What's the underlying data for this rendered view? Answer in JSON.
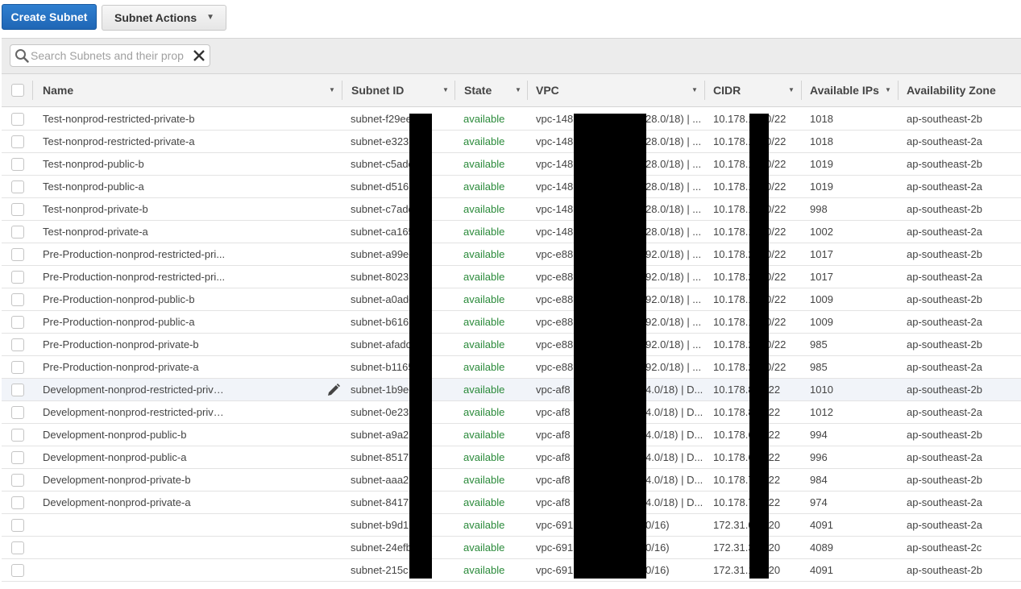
{
  "toolbar": {
    "create_label": "Create Subnet",
    "actions_label": "Subnet Actions",
    "actions_caret": "▼"
  },
  "search": {
    "placeholder": "Search Subnets and their prop"
  },
  "columns": [
    {
      "key": "name",
      "label": "Name"
    },
    {
      "key": "subnet_id",
      "label": "Subnet ID"
    },
    {
      "key": "state",
      "label": "State"
    },
    {
      "key": "vpc",
      "label": "VPC"
    },
    {
      "key": "cidr",
      "label": "CIDR"
    },
    {
      "key": "available_ips",
      "label": "Available IPs"
    },
    {
      "key": "availability_zone",
      "label": "Availability Zone"
    }
  ],
  "sort_arrow": "▼",
  "colors": {
    "accent": "#1f66b5",
    "state_available": "#2a8a3a",
    "selected_row": "#f1f4f9"
  },
  "icons": {
    "search": "search-icon",
    "clear": "close-icon",
    "edit": "pencil-icon"
  },
  "rows": [
    {
      "name": "Test-nonprod-restricted-private-b",
      "subnet_id": "subnet-f29ee",
      "state": "available",
      "vpc": "vpc-148",
      "vpc_tail": "28.0/18) | ...",
      "cidr": "10.178.1",
      "cidr_tail": "0/22",
      "available_ips": "1018",
      "availability_zone": "ap-southeast-2b"
    },
    {
      "name": "Test-nonprod-restricted-private-a",
      "subnet_id": "subnet-e323",
      "state": "available",
      "vpc": "vpc-148",
      "vpc_tail": "28.0/18) | ...",
      "cidr": "10.178.1",
      "cidr_tail": "0/22",
      "available_ips": "1018",
      "availability_zone": "ap-southeast-2a"
    },
    {
      "name": "Test-nonprod-public-b",
      "subnet_id": "subnet-c5add",
      "state": "available",
      "vpc": "vpc-148",
      "vpc_tail": "28.0/18) | ...",
      "cidr": "10.178.1",
      "cidr_tail": "0/22",
      "available_ips": "1019",
      "availability_zone": "ap-southeast-2b"
    },
    {
      "name": "Test-nonprod-public-a",
      "subnet_id": "subnet-d5165",
      "state": "available",
      "vpc": "vpc-148",
      "vpc_tail": "28.0/18) | ...",
      "cidr": "10.178.1",
      "cidr_tail": "0/22",
      "available_ips": "1019",
      "availability_zone": "ap-southeast-2a"
    },
    {
      "name": "Test-nonprod-private-b",
      "subnet_id": "subnet-c7add",
      "state": "available",
      "vpc": "vpc-148",
      "vpc_tail": "28.0/18) | ...",
      "cidr": "10.178.1",
      "cidr_tail": "0/22",
      "available_ips": "998",
      "availability_zone": "ap-southeast-2b"
    },
    {
      "name": "Test-nonprod-private-a",
      "subnet_id": "subnet-ca165",
      "state": "available",
      "vpc": "vpc-148",
      "vpc_tail": "28.0/18) | ...",
      "cidr": "10.178.1",
      "cidr_tail": "0/22",
      "available_ips": "1002",
      "availability_zone": "ap-southeast-2a"
    },
    {
      "name": "Pre-Production-nonprod-restricted-pri...",
      "subnet_id": "subnet-a99ee",
      "state": "available",
      "vpc": "vpc-e88",
      "vpc_tail": "92.0/18) | ...",
      "cidr": "10.178.2",
      "cidr_tail": "0/22",
      "available_ips": "1017",
      "availability_zone": "ap-southeast-2b"
    },
    {
      "name": "Pre-Production-nonprod-restricted-pri...",
      "subnet_id": "subnet-8023",
      "state": "available",
      "vpc": "vpc-e88",
      "vpc_tail": "92.0/18) | ...",
      "cidr": "10.178.2",
      "cidr_tail": "0/22",
      "available_ips": "1017",
      "availability_zone": "ap-southeast-2a"
    },
    {
      "name": "Pre-Production-nonprod-public-b",
      "subnet_id": "subnet-a0add",
      "state": "available",
      "vpc": "vpc-e88",
      "vpc_tail": "92.0/18) | ...",
      "cidr": "10.178.1",
      "cidr_tail": "0/22",
      "available_ips": "1009",
      "availability_zone": "ap-southeast-2b"
    },
    {
      "name": "Pre-Production-nonprod-public-a",
      "subnet_id": "subnet-b6165",
      "state": "available",
      "vpc": "vpc-e88",
      "vpc_tail": "92.0/18) | ...",
      "cidr": "10.178.1",
      "cidr_tail": "0/22",
      "available_ips": "1009",
      "availability_zone": "ap-southeast-2a"
    },
    {
      "name": "Pre-Production-nonprod-private-b",
      "subnet_id": "subnet-afadd",
      "state": "available",
      "vpc": "vpc-e88",
      "vpc_tail": "92.0/18) | ...",
      "cidr": "10.178.2",
      "cidr_tail": "0/22",
      "available_ips": "985",
      "availability_zone": "ap-southeast-2b"
    },
    {
      "name": "Pre-Production-nonprod-private-a",
      "subnet_id": "subnet-b1165",
      "state": "available",
      "vpc": "vpc-e88",
      "vpc_tail": "92.0/18) | ...",
      "cidr": "10.178.2",
      "cidr_tail": "0/22",
      "available_ips": "985",
      "availability_zone": "ap-southeast-2a"
    },
    {
      "name": "Development-nonprod-restricted-private-b",
      "subnet_id": "subnet-1b9ee",
      "state": "available",
      "vpc": "vpc-af8",
      "vpc_tail": "4.0/18) | D...",
      "cidr": "10.178.8",
      "cidr_tail": "/22",
      "available_ips": "1010",
      "availability_zone": "ap-southeast-2b"
    },
    {
      "name": "Development-nonprod-restricted-private-a",
      "subnet_id": "subnet-0e23",
      "state": "available",
      "vpc": "vpc-af8",
      "vpc_tail": "4.0/18) | D...",
      "cidr": "10.178.8",
      "cidr_tail": "/22",
      "available_ips": "1012",
      "availability_zone": "ap-southeast-2a"
    },
    {
      "name": "Development-nonprod-public-b",
      "subnet_id": "subnet-a9a2",
      "state": "available",
      "vpc": "vpc-af8",
      "vpc_tail": "4.0/18) | D...",
      "cidr": "10.178.6",
      "cidr_tail": "/22",
      "available_ips": "994",
      "availability_zone": "ap-southeast-2b"
    },
    {
      "name": "Development-nonprod-public-a",
      "subnet_id": "subnet-8517",
      "state": "available",
      "vpc": "vpc-af8",
      "vpc_tail": "4.0/18) | D...",
      "cidr": "10.178.6",
      "cidr_tail": "/22",
      "available_ips": "996",
      "availability_zone": "ap-southeast-2a"
    },
    {
      "name": "Development-nonprod-private-b",
      "subnet_id": "subnet-aaa2",
      "state": "available",
      "vpc": "vpc-af8",
      "vpc_tail": "4.0/18) | D...",
      "cidr": "10.178.7",
      "cidr_tail": "/22",
      "available_ips": "984",
      "availability_zone": "ap-southeast-2b"
    },
    {
      "name": "Development-nonprod-private-a",
      "subnet_id": "subnet-8417",
      "state": "available",
      "vpc": "vpc-af8",
      "vpc_tail": "4.0/18) | D...",
      "cidr": "10.178.7",
      "cidr_tail": "/22",
      "available_ips": "974",
      "availability_zone": "ap-southeast-2a"
    },
    {
      "name": "",
      "subnet_id": "subnet-b9d1",
      "state": "available",
      "vpc": "vpc-691",
      "vpc_tail": "0/16)",
      "cidr": "172.31.0",
      "cidr_tail": "/20",
      "available_ips": "4091",
      "availability_zone": "ap-southeast-2a"
    },
    {
      "name": "",
      "subnet_id": "subnet-24efb",
      "state": "available",
      "vpc": "vpc-691",
      "vpc_tail": "0/16)",
      "cidr": "172.31.3",
      "cidr_tail": "/20",
      "available_ips": "4089",
      "availability_zone": "ap-southeast-2c"
    },
    {
      "name": "",
      "subnet_id": "subnet-215c",
      "state": "available",
      "vpc": "vpc-691",
      "vpc_tail": "0/16)",
      "cidr": "172.31.1",
      "cidr_tail": "/20",
      "available_ips": "4091",
      "availability_zone": "ap-southeast-2b"
    }
  ],
  "selected_row_index": 12
}
